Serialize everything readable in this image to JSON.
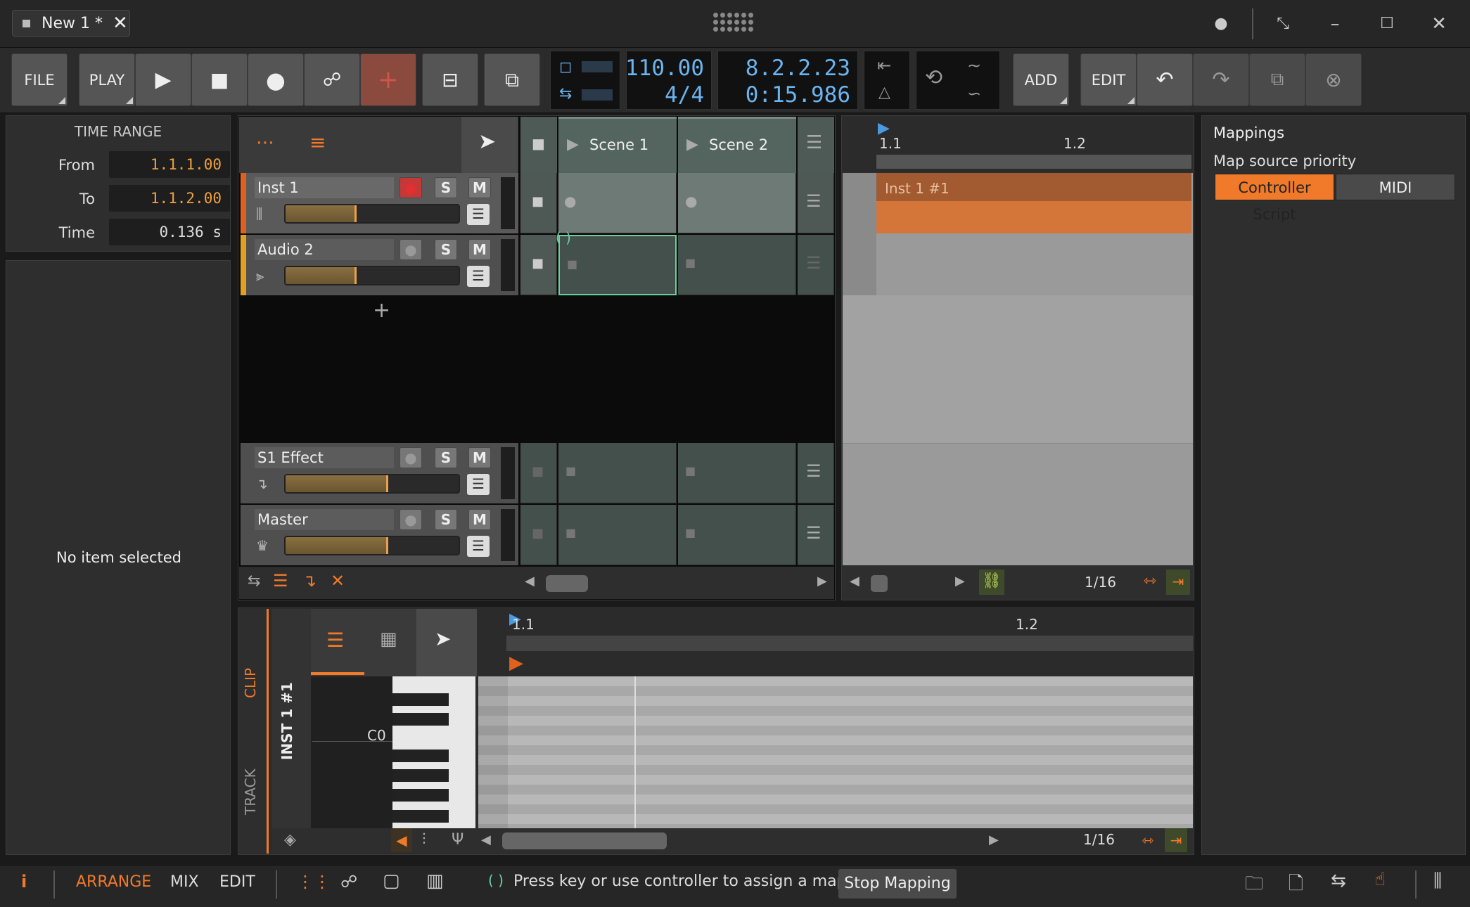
{
  "titlebar": {
    "tab_title": "New 1 *"
  },
  "toolbar": {
    "file": "FILE",
    "play": "PLAY",
    "add": "ADD",
    "edit": "EDIT",
    "tempo": "110.00",
    "time_signature": "4/4",
    "position_beats": "8.2.2.23",
    "position_time": "0:15.986"
  },
  "inspector": {
    "heading": "TIME RANGE",
    "from_label": "From",
    "from_value": "1.1.1.00",
    "to_label": "To",
    "to_value": "1.1.2.00",
    "time_label": "Time",
    "time_value": "0.136 s",
    "empty_text": "No item selected"
  },
  "scenes": [
    "Scene 1",
    "Scene 2"
  ],
  "tracks": [
    {
      "name": "Inst 1"
    },
    {
      "name": "Audio 2"
    },
    {
      "name": "S1 Effect"
    },
    {
      "name": "Master"
    }
  ],
  "track_buttons": {
    "solo": "S",
    "mute": "M"
  },
  "arranger": {
    "ruler_1": "1.1",
    "ruler_2": "1.2",
    "clip_name": "Inst 1 #1",
    "grid": "1/16"
  },
  "mappings": {
    "title": "Mappings",
    "subtitle": "Map source priority",
    "option_1": "Controller Script",
    "option_2": "MIDI"
  },
  "editor": {
    "clip_tab": "CLIP",
    "track_tab": "TRACK",
    "clip_name": "INST 1 #1",
    "note_label": "C0",
    "ruler_1": "1.1",
    "ruler_2": "1.2",
    "grid": "1/16"
  },
  "bottombar": {
    "arrange": "ARRANGE",
    "mix": "MIX",
    "edit": "EDIT",
    "hint": "Press key or use controller to assign a mapping",
    "stop_mapping": "Stop Mapping"
  },
  "colors": {
    "accent": "#f07a2a",
    "lcd": "#6ab4ef",
    "record": "#e03030",
    "inst_track": "#e0601e",
    "audio_track": "#e0a020"
  }
}
